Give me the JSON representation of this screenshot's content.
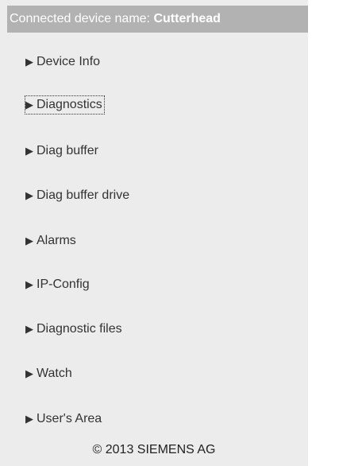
{
  "header": {
    "prefix": "Connected device name:",
    "device_name": "Cutterhead"
  },
  "icons": {
    "nav_arrow": "triangle-right-icon"
  },
  "nav": {
    "items": [
      {
        "label": "Device Info"
      },
      {
        "label": "Diagnostics"
      },
      {
        "label": "Diag buffer"
      },
      {
        "label": "Diag buffer drive"
      },
      {
        "label": "Alarms"
      },
      {
        "label": "IP-Config"
      },
      {
        "label": "Diagnostic files"
      },
      {
        "label": "Watch"
      },
      {
        "label": "User's Area"
      }
    ]
  },
  "footer": {
    "copyright": "© 2013 SIEMENS AG"
  }
}
